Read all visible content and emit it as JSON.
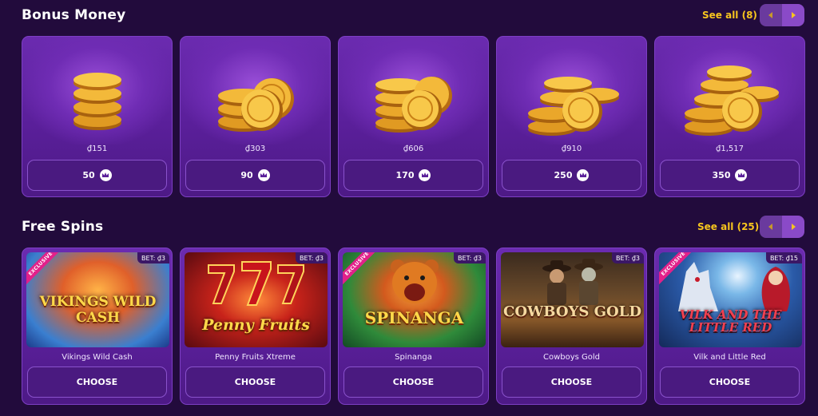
{
  "bonus": {
    "title": "Bonus Money",
    "see_all": "See all (8)",
    "items": [
      {
        "amount": "₫151",
        "price": "50"
      },
      {
        "amount": "₫303",
        "price": "90"
      },
      {
        "amount": "₫606",
        "price": "170"
      },
      {
        "amount": "₫910",
        "price": "250"
      },
      {
        "amount": "₫1,517",
        "price": "350"
      }
    ]
  },
  "spins": {
    "title": "Free Spins",
    "see_all": "See all (25)",
    "choose_label": "CHOOSE",
    "exclusive_label": "EXCLUSIVE",
    "games": [
      {
        "name": "Vikings Wild Cash",
        "bet": "BET: ₫3",
        "logo": "VIKINGS WILD CASH",
        "exclusive": true
      },
      {
        "name": "Penny Fruits Xtreme",
        "bet": "BET: ₫3",
        "logo": "Penny Fruits",
        "exclusive": false
      },
      {
        "name": "Spinanga",
        "bet": "BET: ₫3",
        "logo": "SPINANGA",
        "exclusive": true
      },
      {
        "name": "Cowboys Gold",
        "bet": "BET: ₫3",
        "logo": "COWBOYS GOLD",
        "exclusive": false
      },
      {
        "name": "Vilk and Little Red",
        "bet": "BET: ₫15",
        "logo": "VILK AND THE LITTLE RED",
        "exclusive": true
      }
    ]
  },
  "colors": {
    "background": "#220b3c",
    "card": "#5a1f9a",
    "accent_gold": "#f7c51e",
    "exclusive": "#e2208a"
  },
  "icons": {
    "crown": "crown-icon",
    "prev": "chevron-left-icon",
    "next": "chevron-right-icon"
  }
}
